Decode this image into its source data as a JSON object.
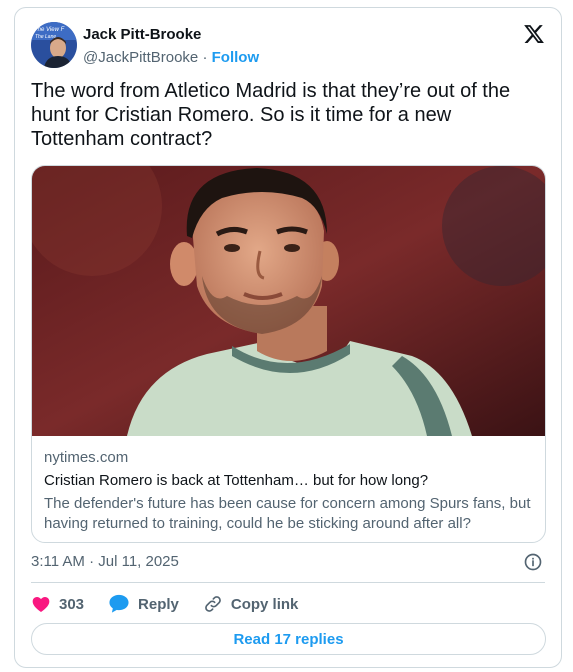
{
  "author": {
    "name": "Jack Pitt-Brooke",
    "handle": "@JackPittBrooke",
    "separator": "·",
    "follow_label": "Follow",
    "avatar_text": [
      "The View F",
      "The Lane"
    ]
  },
  "tweet": {
    "text": "The word from Atletico Madrid is that they’re out of the hunt for Cristian Romero. So is it time for a new Tottenham contract?"
  },
  "link_card": {
    "domain": "nytimes.com",
    "title": "Cristian Romero is back at Tottenham… but for how long?",
    "description": "The defender's future has been cause for concern among Spurs fans, but having returned to training, could he be sticking around after all?"
  },
  "meta": {
    "timestamp": "3:11 AM · Jul 11, 2025"
  },
  "actions": {
    "like_count": "303",
    "reply_label": "Reply",
    "copy_label": "Copy link"
  },
  "read_replies_label": "Read 17 replies",
  "icons": {
    "logo": "x-logo-icon",
    "info": "info-icon",
    "like": "heart-icon",
    "reply": "speech-bubble-icon",
    "copy": "link-icon"
  },
  "colors": {
    "accent": "#1d9bf0",
    "like": "#f91880",
    "secondary_text": "#536471",
    "border": "#cfd9de"
  }
}
